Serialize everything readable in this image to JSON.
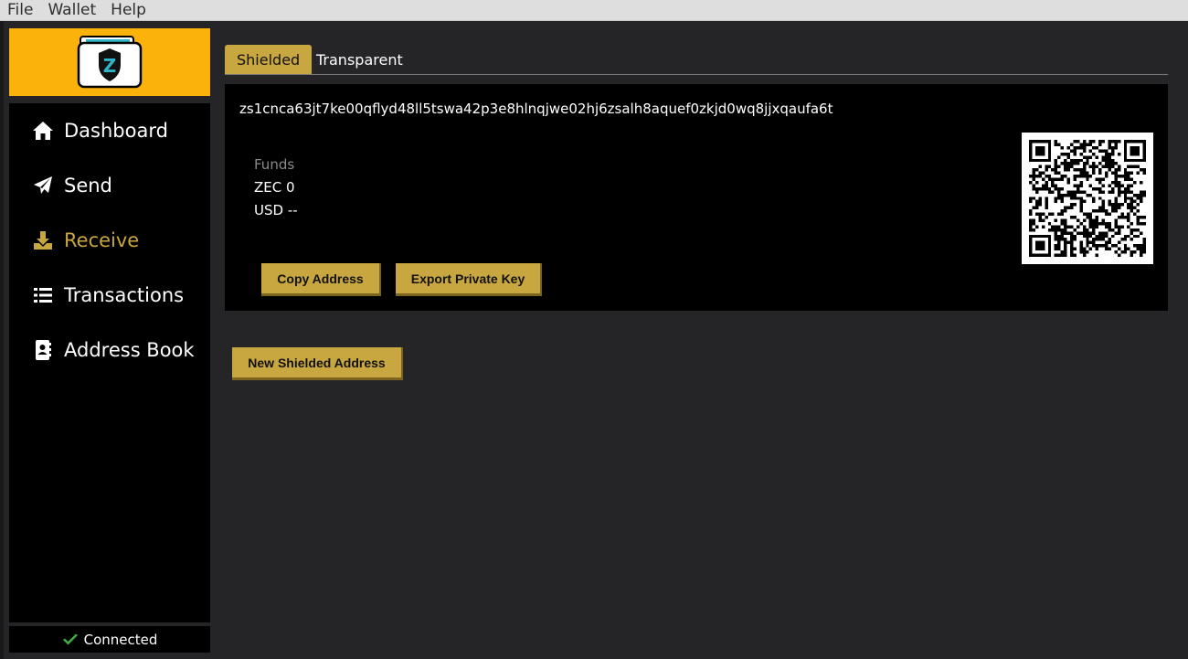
{
  "menu": {
    "items": [
      "File",
      "Wallet",
      "Help"
    ]
  },
  "sidebar": {
    "items": [
      {
        "label": "Dashboard",
        "icon": "home-icon"
      },
      {
        "label": "Send",
        "icon": "paper-plane-icon"
      },
      {
        "label": "Receive",
        "icon": "download-icon",
        "active": true
      },
      {
        "label": "Transactions",
        "icon": "list-icon"
      },
      {
        "label": "Address Book",
        "icon": "address-book-icon"
      }
    ],
    "status": {
      "label": "Connected",
      "icon": "check-icon",
      "color": "#3cb043"
    }
  },
  "colors": {
    "accent": "#c8a640",
    "logo_bg": "#fbb30c",
    "panel_bg": "#000000",
    "app_bg": "#252527"
  },
  "receive": {
    "tabs": [
      {
        "label": "Shielded",
        "active": true
      },
      {
        "label": "Transparent",
        "active": false
      }
    ],
    "address": "zs1cnca63jt7ke00qflyd48ll5tswa42p3e8hlnqjwe02hj6zsalh8aquef0zkjd0wq8jjxqaufa6t",
    "funds": {
      "label": "Funds",
      "zec": "ZEC 0",
      "usd": "USD --"
    },
    "copy_label": "Copy Address",
    "export_label": "Export Private Key",
    "new_address_label": "New Shielded Address"
  }
}
